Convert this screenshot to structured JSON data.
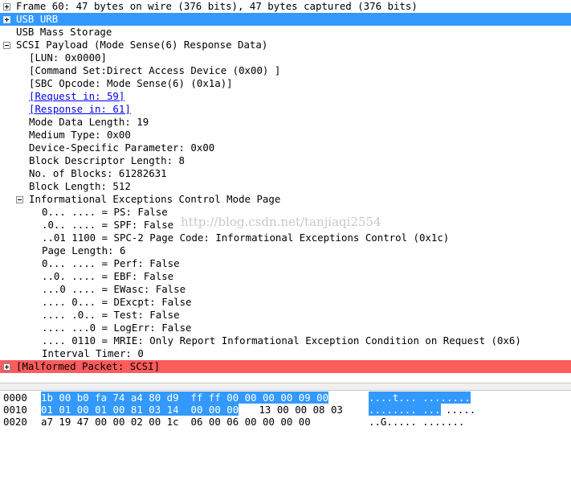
{
  "tree": {
    "frame": "Frame 60: 47 bytes on wire (376 bits), 47 bytes captured (376 bits)",
    "usb_urb": "USB URB",
    "usb_mass_storage": "USB Mass Storage",
    "scsi_payload": "SCSI Payload (Mode Sense(6) Response Data)",
    "lun": "[LUN: 0x0000]",
    "command_set": "[Command Set:Direct Access Device (0x00) ]",
    "sbc_opcode": "[SBC Opcode: Mode Sense(6) (0x1a)]",
    "request_in": "[Request in: 59]",
    "response_in": "[Response in: 61]",
    "mode_data_length": "Mode Data Length: 19",
    "medium_type": "Medium Type: 0x00",
    "device_specific": "Device-Specific Parameter: 0x00",
    "block_descriptor_length": "Block Descriptor Length: 8",
    "no_of_blocks": "No. of Blocks: 61282631",
    "block_length": "Block Length: 512",
    "iec_mode_page": "Informational Exceptions Control Mode Page",
    "ps": "0... .... = PS: False",
    "spf": ".0.. .... = SPF: False",
    "spc2_page_code": "..01 1100 = SPC-2 Page Code: Informational Exceptions Control (0x1c)",
    "page_length": "Page Length: 6",
    "perf": "0... .... = Perf: False",
    "ebf": "..0. .... = EBF: False",
    "ewasc": "...0 .... = EWasc: False",
    "dexcpt": ".... 0... = DExcpt: False",
    "test": ".... .0.. = Test: False",
    "logerr": ".... ...0 = LogErr: False",
    "mrie": ".... 0110 = MRIE: Only Report Informational Exception Condition on Request (0x6)",
    "interval_timer": "Interval Timer: 0",
    "malformed": "[Malformed Packet: SCSI]"
  },
  "watermark": "http://blog.csdn.net/tanjiaqi2554",
  "hex": {
    "rows": [
      {
        "offset": "0000",
        "hl_bytes": "1b 00 b0 fa 74 a4 80 d9  ff ff 00 00 00 00 09 00",
        "rest_bytes": "",
        "hl_ascii": "....t... ........",
        "rest_ascii": ""
      },
      {
        "offset": "0010",
        "hl_bytes": "01 01 00 01 00 81 03 14  00 00 00",
        "rest_bytes": " 13 00 00 08 03",
        "hl_ascii": "........ ...",
        "rest_ascii": "....."
      },
      {
        "offset": "0020",
        "hl_bytes": "",
        "rest_bytes": "a7 19 47 00 00 02 00 1c  06 00 06 00 00 00 00",
        "hl_ascii": "",
        "rest_ascii": "..G..... ......."
      }
    ]
  },
  "colors": {
    "selection": "#3399ff",
    "malformed": "#ff5c5c"
  }
}
